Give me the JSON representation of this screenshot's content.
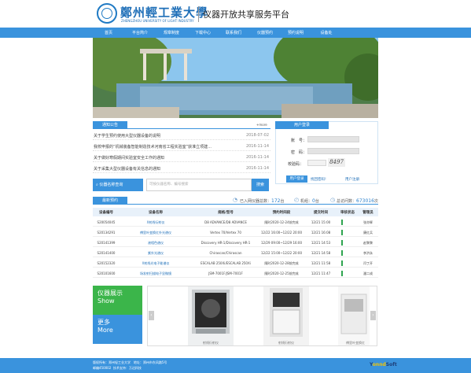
{
  "header": {
    "logo_cn": "鄭州輕工業大學",
    "logo_en": "ZHENGZHOU UNIVERSITY OF LIGHT INDUSTRY",
    "site_title": "仪器开放共享服务平台"
  },
  "nav": [
    "首页",
    "平台简介",
    "规章制度",
    "下载中心",
    "联系我们",
    "仪器预约",
    "预约说明",
    "设备处"
  ],
  "notices": {
    "tab": "通知公告",
    "more": "+more",
    "items": [
      {
        "title": "关于学生预约使用大型仪器设备的说明",
        "date": "2018-07-02"
      },
      {
        "title": "我校申报的“机械装备智能制造技术河南省工程实验室”获准立项建...",
        "date": "2016-11-14"
      },
      {
        "title": "关于做好寒假期间实验室安全工作的通知",
        "date": "2016-11-14"
      },
      {
        "title": "关于采集大型仪器设备有关信息的通知",
        "date": "2016-11-14"
      }
    ]
  },
  "login": {
    "tab": "用户登录",
    "account_label": "账　号：",
    "password_label": "密　码：",
    "captcha_label": "校验码：",
    "captcha_text": "8497",
    "login_button": "用户登录",
    "forgot_link": "找回密码!",
    "register_link": "用户注册"
  },
  "search": {
    "label": "仪器名称查询",
    "placeholder": "可按仪器名称、编号搜索",
    "button": "搜索"
  },
  "stats": {
    "users_label": "已入网仪器总数：",
    "users_value": "172",
    "users_unit": "台",
    "reservations_label": "机组：",
    "reservations_value": "0",
    "reservations_unit": "台",
    "visits_label": "总访问数：",
    "visits_value": "673016",
    "visits_unit": "次"
  },
  "latest": {
    "tab": "最新预约",
    "headers": [
      "设备编号",
      "设备名称",
      "规格/型号",
      "预约时间段",
      "提交时间",
      "审核状态",
      "管理员"
    ],
    "rows": [
      [
        "S20054045",
        "X射线衍射仪",
        "D8 ADVANCE/D8 ADVANCE",
        "随时2020-12-24前完成",
        "12/21 15:00",
        "",
        "张亦辉"
      ],
      [
        "S20134291",
        "傅里叶变换红外光谱仪",
        "Vertex 70/Vertex 70",
        "12/22 16:00~12/22 20:00",
        "12/21 16:08",
        "",
        "康红兵"
      ],
      [
        "S20141399",
        "液相色谱仪",
        "Discovery HR-1/Discovery HR-1",
        "12/29 09:00~12/29 16:00",
        "12/21 14:53",
        "",
        "赵黎黎"
      ],
      [
        "S20141400",
        "紫外光谱仪",
        "Chirascan/Chirascan",
        "12/22 15:00~12/22 20:00",
        "12/21 14:58",
        "",
        "李洪永"
      ],
      [
        "S20152320",
        "X射线光电子能谱仪",
        "ESCALAB 250Xi/ESCALAB 250Xi",
        "随时2020-12-28前完成",
        "12/21 11:58",
        "",
        "闫丁开"
      ],
      [
        "S20101600",
        "场发射扫描电子显微镜",
        "JSM-7001F/JSM-7001F",
        "随时2020-12-25前完成",
        "12/21 11:47",
        "",
        "潘二成"
      ]
    ]
  },
  "tiles": {
    "show_line1": "仪器展示",
    "show_line2": "Show",
    "more_line1": "更多",
    "more_line2": "More"
  },
  "gallery": {
    "captions": [
      "射线衍射仪",
      "射线衍射仪",
      "傅里叶变换红"
    ]
  },
  "footer": {
    "line1_a": "版权所有：",
    "line1_b": "郑州轻工业大学",
    "line1_c": "地址：",
    "line1_d": "郑州市东风路5号",
    "line2_a": "邮编450002",
    "line2_b": "技术支持：",
    "line2_c": "万达科技",
    "brand_a": "Y",
    "brand_b": "onnd",
    "brand_c": "Soft"
  },
  "colors": {
    "primary": "#3a93dd",
    "green": "#3bb54a",
    "link": "#1f6fb8"
  }
}
